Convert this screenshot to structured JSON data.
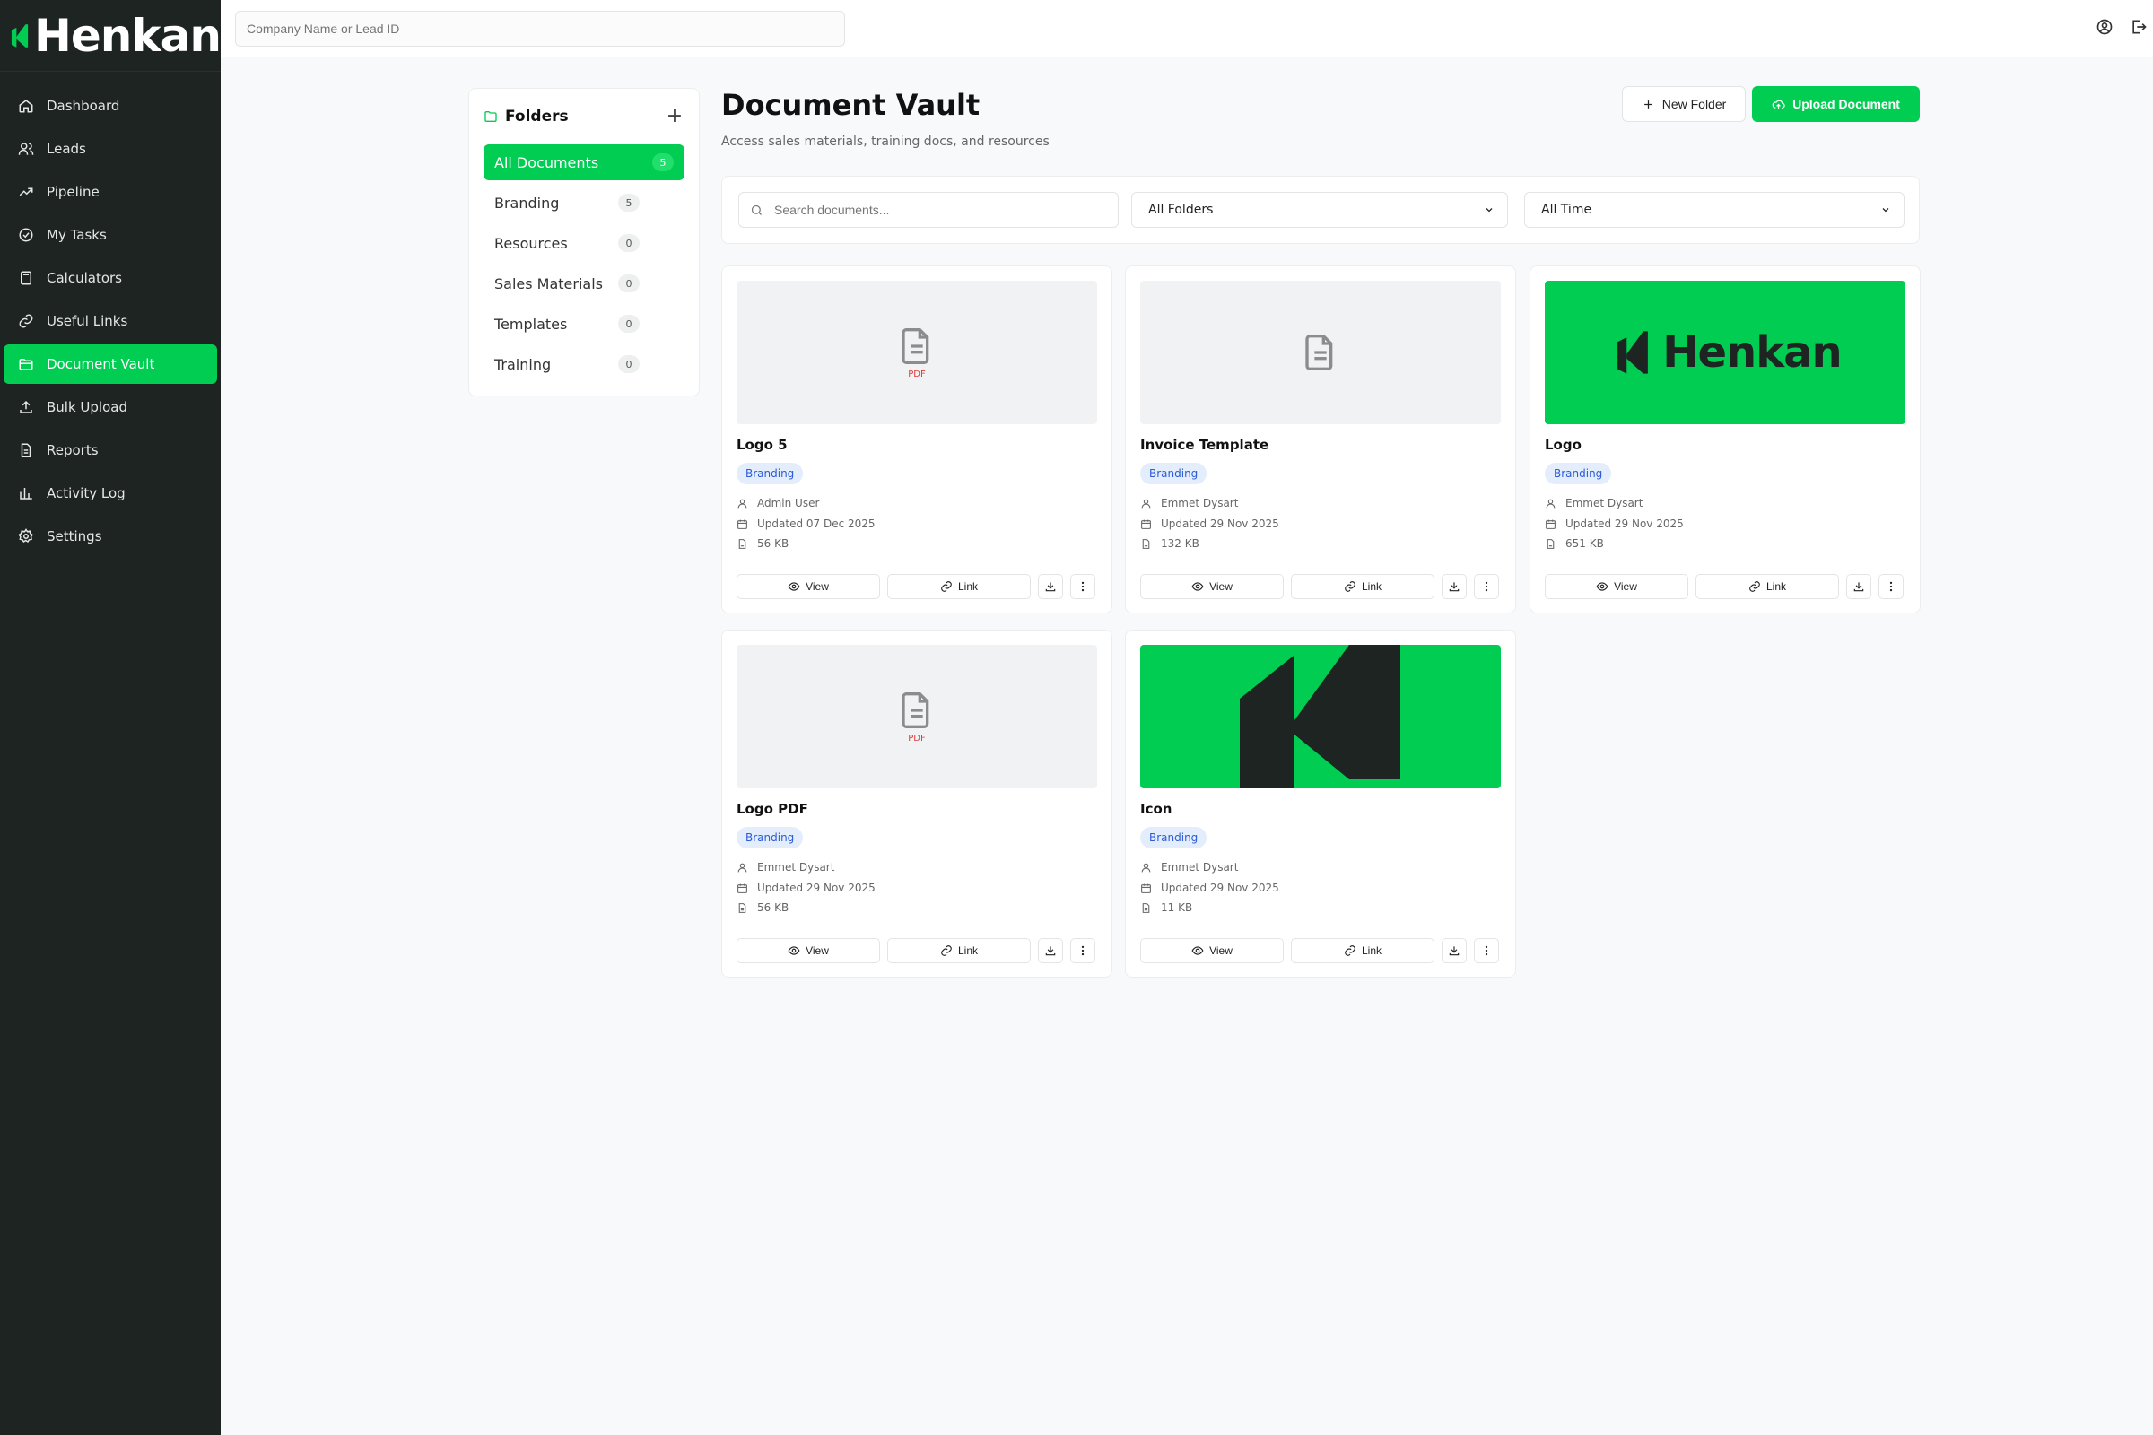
{
  "brand": {
    "name": "Henkan"
  },
  "colors": {
    "accent": "#00cd52",
    "sidebar": "#1e2422",
    "tag_bg": "#e4edfc",
    "tag_text": "#2b5bd7",
    "pdf_label": "#e23a3a"
  },
  "topbar": {
    "search_placeholder": "Company Name or Lead ID",
    "icons": [
      "user-circle-icon",
      "logout-icon"
    ]
  },
  "sidebar": {
    "items": [
      {
        "label": "Dashboard",
        "icon": "home-icon"
      },
      {
        "label": "Leads",
        "icon": "users-icon"
      },
      {
        "label": "Pipeline",
        "icon": "trend-icon"
      },
      {
        "label": "My Tasks",
        "icon": "check-circle-icon"
      },
      {
        "label": "Calculators",
        "icon": "calculator-icon"
      },
      {
        "label": "Useful Links",
        "icon": "link-icon"
      },
      {
        "label": "Document Vault",
        "icon": "folder-open-icon",
        "active": true
      },
      {
        "label": "Bulk Upload",
        "icon": "upload-icon"
      },
      {
        "label": "Reports",
        "icon": "file-icon"
      },
      {
        "label": "Activity Log",
        "icon": "bar-chart-icon"
      },
      {
        "label": "Settings",
        "icon": "gear-icon"
      }
    ]
  },
  "folders": {
    "title": "Folders",
    "items": [
      {
        "label": "All Documents",
        "count": "5",
        "active": true
      },
      {
        "label": "Branding",
        "count": "5"
      },
      {
        "label": "Resources",
        "count": "0"
      },
      {
        "label": "Sales Materials",
        "count": "0"
      },
      {
        "label": "Templates",
        "count": "0"
      },
      {
        "label": "Training",
        "count": "0"
      }
    ]
  },
  "main": {
    "title": "Document Vault",
    "subtitle": "Access sales materials, training docs, and resources",
    "new_folder_label": "New Folder",
    "upload_label": "Upload Document"
  },
  "filters": {
    "search_placeholder": "Search documents...",
    "folder_select": "All Folders",
    "time_select": "All Time"
  },
  "documents": [
    {
      "title": "Logo 5",
      "tag": "Branding",
      "author": "Admin User",
      "updated": "Updated 07 Dec 2025",
      "size": "56 KB",
      "thumb": "pdf",
      "thumb_label": "PDF"
    },
    {
      "title": "Invoice Template",
      "tag": "Branding",
      "author": "Emmet Dysart",
      "updated": "Updated 29 Nov 2025",
      "size": "132 KB",
      "thumb": "doc"
    },
    {
      "title": "Logo",
      "tag": "Branding",
      "author": "Emmet Dysart",
      "updated": "Updated 29 Nov 2025",
      "size": "651 KB",
      "thumb": "logo",
      "thumb_label": "Henkan"
    },
    {
      "title": "Logo PDF",
      "tag": "Branding",
      "author": "Emmet Dysart",
      "updated": "Updated 29 Nov 2025",
      "size": "56 KB",
      "thumb": "pdf",
      "thumb_label": "PDF"
    },
    {
      "title": "Icon",
      "tag": "Branding",
      "author": "Emmet Dysart",
      "updated": "Updated 29 Nov 2025",
      "size": "11 KB",
      "thumb": "icon"
    }
  ],
  "card_actions": {
    "view": "View",
    "link": "Link"
  }
}
